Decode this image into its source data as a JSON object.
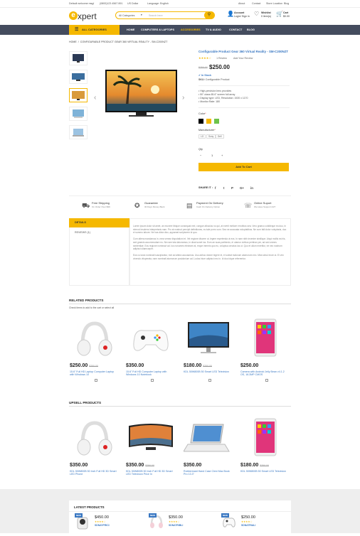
{
  "topbar": {
    "welcome": "Default welcome msg!",
    "phone": "(0800)123 4567 891",
    "currency": "US Dollar",
    "language": "Language: English",
    "about": "About",
    "contact": "Contact",
    "store": "Store Location",
    "blog": "Blog"
  },
  "header": {
    "logo_letter": "e",
    "logo_text": "xpert",
    "search_category": "All Categories",
    "search_placeholder": "Search here",
    "account_title": "Account",
    "account_sub": "Login/ Sign in",
    "wishlist_title": "Wishlist",
    "wishlist_sub": "0 item(s)",
    "cart_title": "Cart",
    "cart_sub": "$0.00"
  },
  "nav": {
    "all_categories": "ALL CATEGORIES",
    "items": [
      "HOME",
      "COMPUTERS & LAPTOPS",
      "ACCESSORIES",
      "TV & AUDIO",
      "CONTACT",
      "BLOG"
    ]
  },
  "breadcrumb": {
    "home": "HOME",
    "current": "CONFIGURABLE PRODUCT GEAR 360 VIRTUAL REALITY - SM-C200NZT"
  },
  "product": {
    "title": "Configurable Product Gear 360 Virtual Reality - SM-C200NZT",
    "reviews": "1 Review",
    "add_review": "Add Your Review",
    "price": "$250.00",
    "old_price": "$250.00",
    "stock": "In Stock",
    "sku_label": "SKU",
    "sku": "Configurable Product",
    "bullets": [
      "High-precision lens provides",
      "50\"-class 65.6\" screen full array",
      "Display type: LED, Resolution: 1920 x 1170",
      "Monitor Rate: 180"
    ],
    "color_label": "Color",
    "manufacturer_label": "Manufacturer",
    "manufacturers": [
      "LG",
      "Sony",
      "Dell"
    ],
    "qty_label": "Qty",
    "qty": "1",
    "add_to_cart": "Add To Cart",
    "share": "SHARE IT :"
  },
  "features": [
    {
      "title": "Free Shipping",
      "sub": "On Order Over $99"
    },
    {
      "title": "Guarantee",
      "sub": "30 Days Money Back"
    },
    {
      "title": "Payment On Delivery",
      "sub": "Cash On Delivery Option"
    },
    {
      "title": "Online Suport",
      "sub": "We Have Support 24/7"
    }
  ],
  "tabs": {
    "details": "DETAILS",
    "reviews": "REVIEWS (1)"
  },
  "description": [
    "Lorem ipsum dolor sit amet, an munere tibique consequat mel, congue albucius no qui, at everti meliore erroribus sea. Vero graeco cotidieque ea duo, in eirmod insolens interpretaris nam. Pro at nostrud percipit definitiones, eu tale porro cum. Sea ne accusata voluptatibus. Ne cum falli dolor voluptaria, duo ei summo labore. Ne has dicta dico, appareat scriptorem id quo.",
    "Cum altera mandamus in, mea verear disputationi et. Vel regione discere ut, legere expetenda ut eos. In nam nibh invenire similique. Atqui mollis ea his, sed graecis accommodare eu. Ne nam tota laboramus, in dicat sonet ius. Eum an suas partiendo, ei utamur civibus pertinax per, ad sed omnes sententiae. Eos regione nominavi ad. Ius nonumes electram at, reque inermis quo eu, voluptua ornatus ius ut. Quo et ullum evertitur, ne nec nostrum adipisci ullamcorper.",
    "Eos cu iusto nominati suscipiantur, mei ad altera accusamus. Usu adhuc dolore legere et, ei soleat malorum atomorum nec. Mea simul iriure ut. Ei vim vivendo vituperata, nam nominati atomorum posidonium ad. Ludus iriure adipisci nec in. Id duo idque referrentur."
  ],
  "related": {
    "title": "RELATED PRODUCTS",
    "hint": "Check items to add to the cart or select all",
    "items": [
      {
        "price": "$250.00",
        "old": "$250.00",
        "name": "15.6\" Full HD Laptop Computer Laptop with Windows 10"
      },
      {
        "price": "$350.00",
        "old": "",
        "name": "15.6\" Full HD Computer Laptop with Windows 10 Notebook"
      },
      {
        "price": "$180.00",
        "old": "$250.00",
        "name": "KDL 50W800B 50 Smart LED Television"
      },
      {
        "price": "$250.00",
        "old": "",
        "name": "Camera with Android Jelly Bean v4.1.2 OS, 16.3MP CMOS"
      }
    ]
  },
  "upsell": {
    "title": "UPSELL PRODUCTS",
    "items": [
      {
        "price": "$350.00",
        "old": "",
        "name": "KDL 50W800B 50 Inch Full HD 3D Smart LED Phone"
      },
      {
        "price": "$350.00",
        "old": "$250.00",
        "name": "KDL 50W800B 50 Inch Full HD 3D Smart LED Television Price In"
      },
      {
        "price": "$350.00",
        "old": "",
        "name": "Rubbermaid Hand Case Cleni Mac Book Pro 13.3\""
      },
      {
        "price": "$180.00",
        "old": "$250.00",
        "name": "KDL 50W800B 50 Smart LED Television"
      }
    ]
  },
  "latest": {
    "title": "LATEST PRODUCTS",
    "items": [
      {
        "badge": "NEW",
        "price": "$450.00",
        "name": "SDNAYPRICI"
      },
      {
        "badge": "NEW",
        "price": "$350.00",
        "name": "SDNATRIBLI"
      },
      {
        "badge": "NEW",
        "price": "$250.00",
        "name": "SDNATRIALI"
      }
    ]
  },
  "colors": {
    "accent": "#f5b800",
    "nav": "#444c5e",
    "link": "#3a78c2",
    "swatches": [
      "#000000",
      "#f5b800",
      "#6ec34a"
    ]
  }
}
